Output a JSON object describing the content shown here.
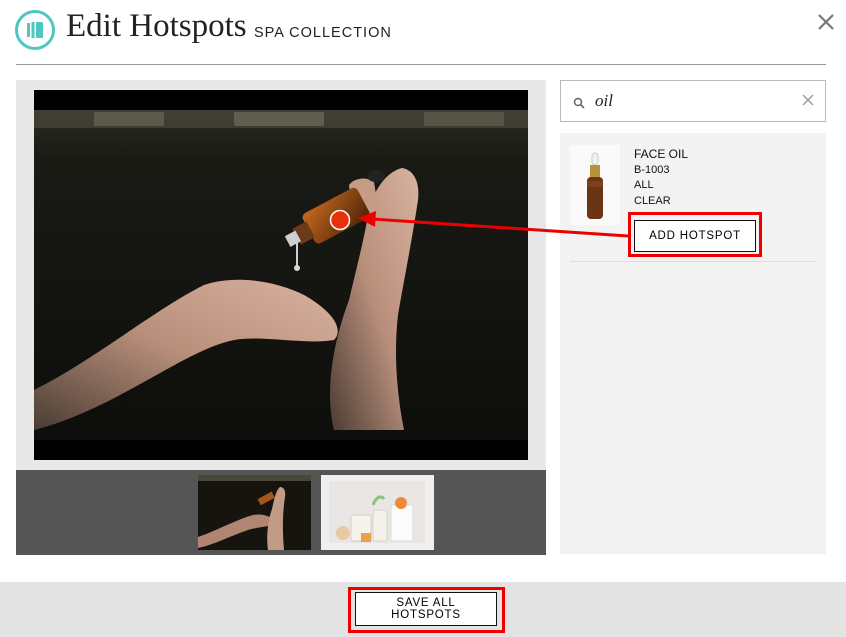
{
  "header": {
    "title": "Edit Hotspots",
    "subtitle": "SPA COLLECTION",
    "logo_icon": "teal-book-logo-icon",
    "close_icon": "close-icon"
  },
  "search": {
    "value": "oil",
    "icon": "search-icon",
    "clear_icon": "clear-icon"
  },
  "results": [
    {
      "name": "FACE OIL",
      "sku": "B-1003",
      "size": "ALL",
      "color": "CLEAR",
      "add_label": "ADD HOTSPOT"
    }
  ],
  "footer": {
    "save_label": "SAVE ALL HOTSPOTS"
  },
  "colors": {
    "accent": "#4ec6c2",
    "hotspot": "#e8300b",
    "annotation": "#e00000"
  }
}
